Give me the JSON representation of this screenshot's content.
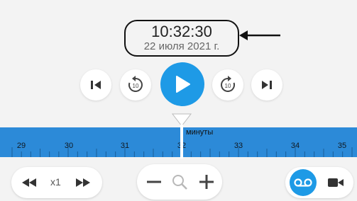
{
  "clock": {
    "time": "10:32:30",
    "date": "22 июля 2021 г."
  },
  "icons": {
    "skip_back": "skip-to-start-icon",
    "rewind_10": "rewind-10-icon",
    "play": "play-icon",
    "forward_10": "forward-10-icon",
    "skip_forward": "skip-to-end-icon",
    "slower": "rewind-icon",
    "faster": "fast-forward-icon",
    "zoom_out": "minus-icon",
    "zoom": "magnifier-icon",
    "zoom_in": "plus-icon",
    "archive": "tape-icon",
    "live": "camera-icon"
  },
  "controls": {
    "rewind_amount": "10",
    "forward_amount": "10"
  },
  "timeline": {
    "unit_label": "минуты",
    "tick_labels": [
      "29",
      "30",
      "31",
      "32",
      "33",
      "34",
      "35"
    ]
  },
  "speed": {
    "value": "x1"
  },
  "colors": {
    "accent": "#1e9ae6",
    "timeline": "#2c8ad8",
    "background": "#f3f3f3"
  }
}
